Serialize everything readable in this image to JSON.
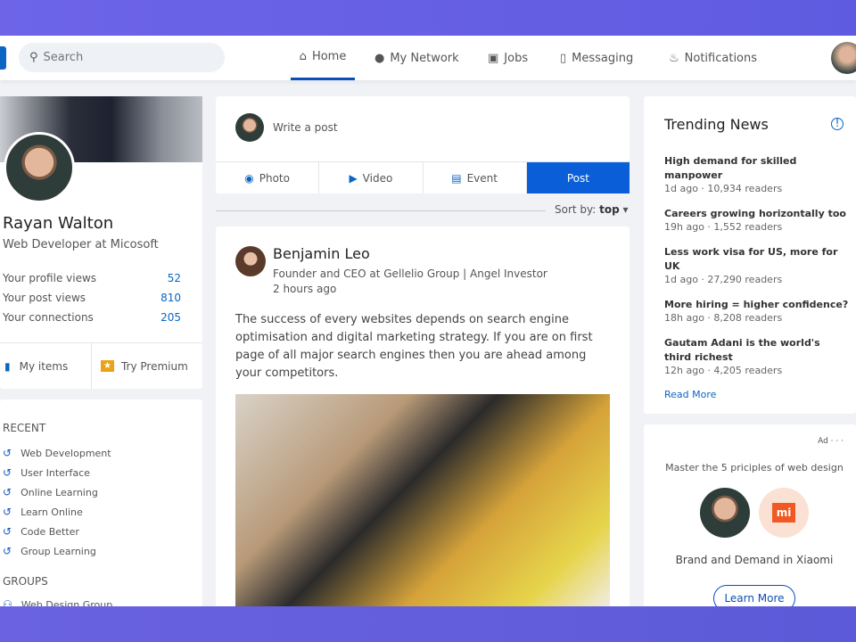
{
  "nav": {
    "search_placeholder": "Search",
    "items": [
      {
        "label": "Home",
        "icon": "home-icon"
      },
      {
        "label": "My Network",
        "icon": "person-icon"
      },
      {
        "label": "Jobs",
        "icon": "briefcase-icon"
      },
      {
        "label": "Messaging",
        "icon": "chat-icon"
      },
      {
        "label": "Notifications",
        "icon": "bell-icon"
      }
    ]
  },
  "profile": {
    "name": "Rayan Walton",
    "title": "Web Developer at Micosoft",
    "stats": [
      {
        "label": "Your profile views",
        "value": "52"
      },
      {
        "label": "Your post views",
        "value": "810"
      },
      {
        "label": "Your connections",
        "value": "205"
      }
    ],
    "my_items": "My items",
    "premium": "Try Premium"
  },
  "recent": {
    "heading": "RECENT",
    "items": [
      "Web Development",
      "User Interface",
      "Online Learning",
      "Learn Online",
      "Code Better",
      "Group Learning"
    ],
    "groups_heading": "GROUPS",
    "groups": [
      "Web Design Group"
    ]
  },
  "compose": {
    "placeholder": "Write a post",
    "tabs": [
      "Photo",
      "Video",
      "Event"
    ],
    "post_label": "Post"
  },
  "sort": {
    "label": "Sort by:",
    "value": "top"
  },
  "post": {
    "author": "Benjamin Leo",
    "headline": "Founder and CEO at Gellelio Group | Angel Investor",
    "time": "2 hours ago",
    "text": "The success of every websites depends on search engine optimisation and digital marketing strategy. If you are on first page of all major search engines then you are ahead among your competitors."
  },
  "trending": {
    "title": "Trending News",
    "items": [
      {
        "title": "High demand for skilled manpower",
        "meta": "1d ago · 10,934 readers"
      },
      {
        "title": "Careers growing horizontally too",
        "meta": "19h ago · 1,552 readers"
      },
      {
        "title": "Less work visa for US, more for UK",
        "meta": "1d ago · 27,290 readers"
      },
      {
        "title": "More hiring = higher confidence?",
        "meta": "18h ago · 8,208 readers"
      },
      {
        "title": "Gautam Adani is the world's third richest",
        "meta": "12h ago · 4,205 readers"
      }
    ],
    "read_more": "Read More"
  },
  "ad": {
    "label": "Ad · · ·",
    "headline": "Master the 5 priciples of web design",
    "brand_logo": "mi",
    "caption": "Brand and Demand in Xiaomi",
    "cta": "Learn More"
  },
  "colors": {
    "accent": "#0a66c2",
    "post_button": "#0a5fd8",
    "background": "#f0f2f5"
  }
}
